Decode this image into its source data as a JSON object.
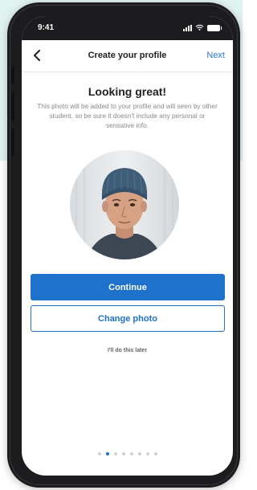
{
  "status_bar": {
    "time": "9:41"
  },
  "nav": {
    "title": "Create your profile",
    "next_label": "Next"
  },
  "content": {
    "heading": "Looking great!",
    "description": "This photo will be added to your profile and will seen by other student, so be sure it doesn't include any personal or sensative info."
  },
  "actions": {
    "continue_label": "Continue",
    "change_photo_label": "Change photo",
    "later_label": "I'll do this later"
  },
  "pagination": {
    "total": 8,
    "active_index": 1
  },
  "colors": {
    "accent": "#1f72cc",
    "background_block": "#e1f3f1",
    "phone_frame": "#1c1c1e"
  },
  "icons": {
    "back": "chevron-left-icon",
    "signal": "signal-icon",
    "wifi": "wifi-icon",
    "battery": "battery-icon"
  }
}
